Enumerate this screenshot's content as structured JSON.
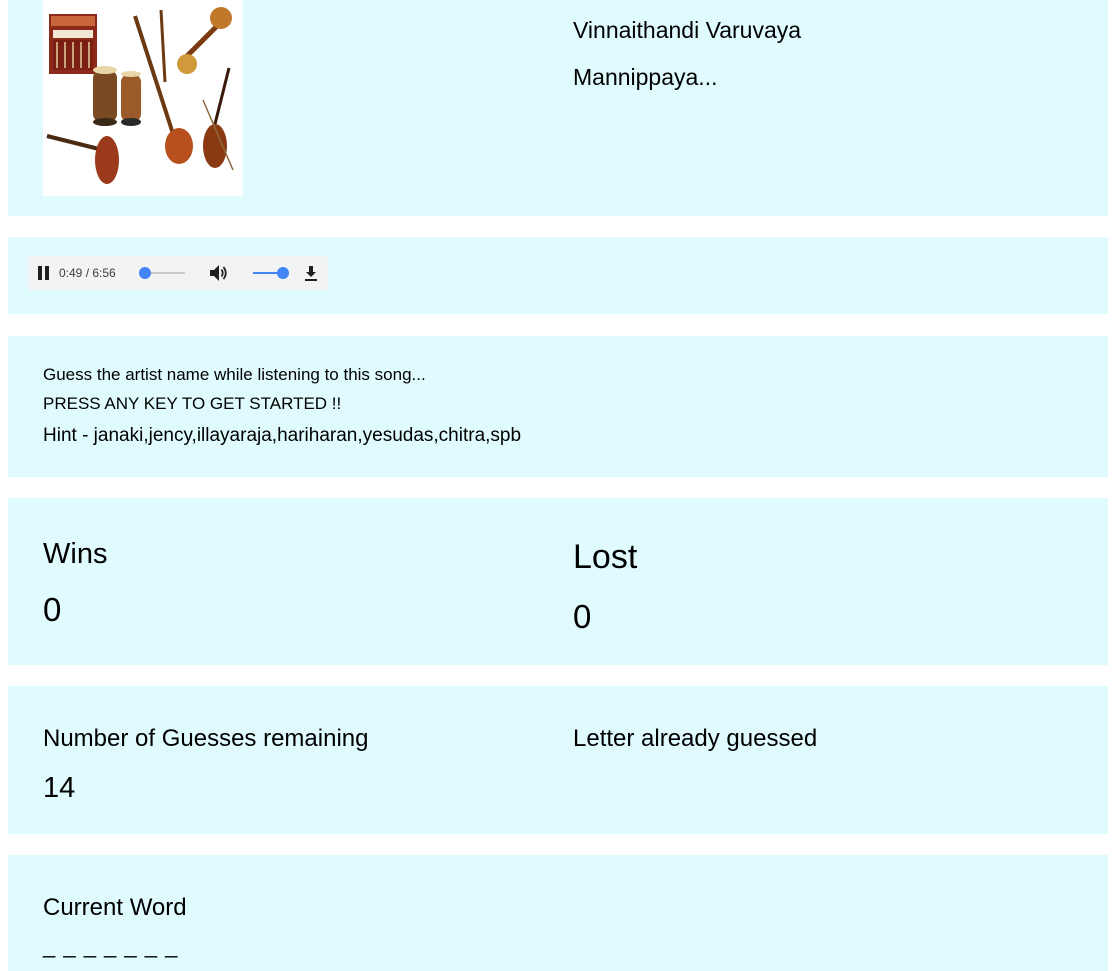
{
  "song": {
    "title_line1": "Vinnaithandi Varuvaya",
    "title_line2": "Mannippaya..."
  },
  "player": {
    "state": "playing",
    "time_display": "0:49 / 6:56",
    "progress": 0.118,
    "volume": 1.0,
    "accent_color": "#4285f4"
  },
  "instructions": {
    "line1": "Guess the artist name while listening to this song...",
    "line2": "PRESS ANY KEY TO GET STARTED !!",
    "hint": "Hint - janaki,jency,illayaraja,hariharan,yesudas,chitra,spb"
  },
  "score": {
    "wins_label": "Wins",
    "wins_value": "0",
    "lost_label": "Lost",
    "lost_value": "0"
  },
  "guesses": {
    "remaining_label": "Number of Guesses remaining",
    "remaining_value": "14",
    "guessed_label": "Letter already guessed",
    "guessed_letters": ""
  },
  "word": {
    "label": "Current Word",
    "display": "_ _ _ _ _ _ _"
  },
  "colors": {
    "panel_background": "#e0fbfd",
    "page_background": "#ffffff"
  }
}
